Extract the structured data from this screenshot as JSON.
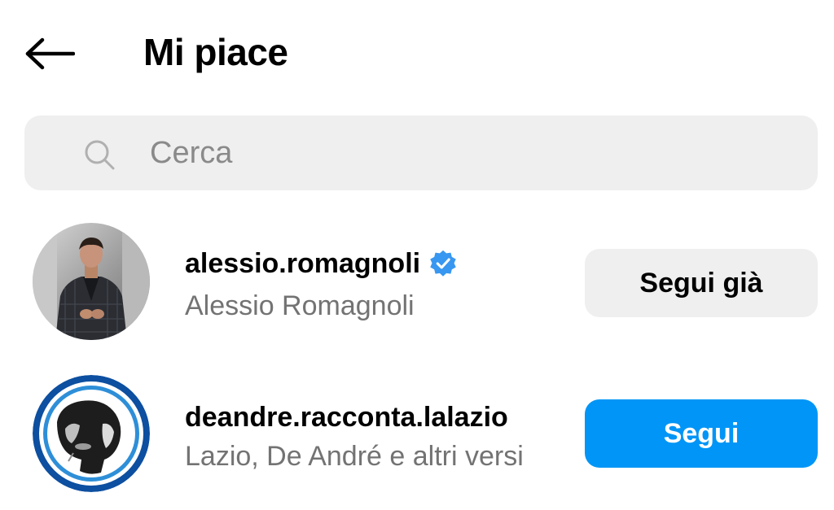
{
  "header": {
    "title": "Mi piace",
    "back_icon": "arrow-left-icon"
  },
  "search": {
    "placeholder": "Cerca",
    "icon": "search-icon"
  },
  "users": [
    {
      "username": "alessio.romagnoli",
      "full_name": "Alessio Romagnoli",
      "verified": true,
      "button_label": "Segui già",
      "button_state": "following"
    },
    {
      "username": "deandre.racconta.lalazio",
      "full_name": "Lazio, De André e altri versi",
      "verified": false,
      "button_label": "Segui",
      "button_state": "follow"
    }
  ],
  "colors": {
    "accent": "#0095f6",
    "verified": "#3897f0",
    "secondary_text": "#737373",
    "surface": "#efefef"
  }
}
